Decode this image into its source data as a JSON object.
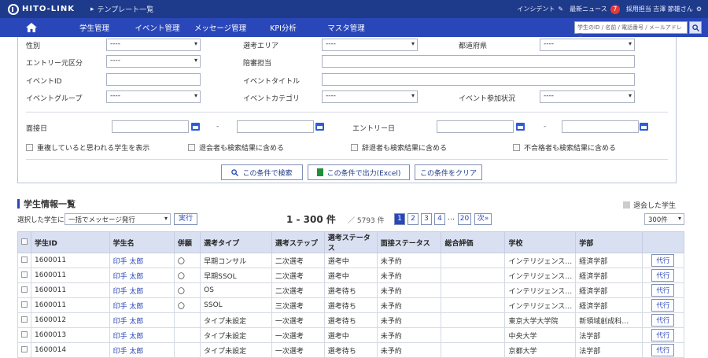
{
  "header": {
    "logo": "HITO-LINK",
    "breadcrumb": "テンプレート一覧",
    "right": [
      {
        "label": "インシデント",
        "icon": "pencil-icon"
      },
      {
        "label": "最新ニュース",
        "badge": "7"
      },
      {
        "label": "採用担当 吉澤 節雄さん",
        "icon": "gear-icon"
      }
    ]
  },
  "nav": {
    "items": [
      "学生管理",
      "イベント管理",
      "メッセージ管理",
      "KPI分析",
      "マスタ管理"
    ],
    "search_placeholder": "学生のID / 名前 / 電話番号 / メールアドレス"
  },
  "filters": {
    "row1": {
      "gender": "性別",
      "gender_val": "----",
      "area": "選考エリア",
      "area_val": "----",
      "pref": "都道府県",
      "pref_val": "----"
    },
    "row2": {
      "entry_class": "エントリー元区分",
      "entry_class_val": "----",
      "recruiter": "陪審担当"
    },
    "row3": {
      "event_id": "イベントID",
      "event_title": "イベントタイトル"
    },
    "row4": {
      "event_group": "イベントグループ",
      "event_group_val": "----",
      "event_cat": "イベントカテゴリ",
      "event_cat_val": "----",
      "event_status": "イベント参加状況",
      "event_status_val": "----"
    },
    "interview_date": "面接日",
    "entry_date": "エントリー日",
    "dash": "-",
    "checks": [
      "重複していると思われる学生を表示",
      "退会者も検索結果に含める",
      "辞退者も検索結果に含める",
      "不合格者も検索結果に含める"
    ],
    "btn_search": "この条件で検索",
    "btn_excel": "この条件で出力(Excel)",
    "btn_clear": "この条件をクリア"
  },
  "list": {
    "title": "学生情報一覧",
    "retired_label": "退会した学生",
    "selected_label": "選択した学生に",
    "bulk_action": "一括でメッセージ発行",
    "run_button": "実行",
    "range": "1 - 300 件",
    "total": "／ 5793 件",
    "pages": [
      "1",
      "2",
      "3",
      "4",
      "…",
      "20",
      "次»"
    ],
    "per_page": "300件"
  },
  "table": {
    "headers": [
      "学生ID",
      "学生名",
      "併願",
      "選考タイプ",
      "選考ステップ",
      "選考ステータス",
      "面接ステータス",
      "総合評価",
      "学校",
      "学部",
      ""
    ],
    "rows": [
      [
        "1600011",
        "印手 太郎",
        "〇",
        "早期コンサル",
        "二次選考",
        "選考中",
        "未予約",
        "",
        "インテリジェンス…",
        "経済学部",
        "代行"
      ],
      [
        "1600011",
        "印手 太郎",
        "〇",
        "早期SSOL",
        "二次選考",
        "選考中",
        "未予約",
        "",
        "インテリジェンス…",
        "経済学部",
        "代行"
      ],
      [
        "1600011",
        "印手 太郎",
        "〇",
        "OS",
        "二次選考",
        "選考待ち",
        "未予約",
        "",
        "インテリジェンス…",
        "経済学部",
        "代行"
      ],
      [
        "1600011",
        "印手 太郎",
        "〇",
        "SSOL",
        "三次選考",
        "選考待ち",
        "未予約",
        "",
        "インテリジェンス…",
        "経済学部",
        "代行"
      ],
      [
        "1600012",
        "印手 太郎",
        "",
        "タイプ未設定",
        "一次選考",
        "選考待ち",
        "未予約",
        "",
        "東京大学大学院",
        "新領域創成科…",
        "代行"
      ],
      [
        "1600013",
        "印手 太郎",
        "",
        "タイプ未設定",
        "一次選考",
        "選考中",
        "未予約",
        "",
        "中央大学",
        "法学部",
        "代行"
      ],
      [
        "1600014",
        "印手 太郎",
        "",
        "タイプ未設定",
        "一次選考",
        "選考待ち",
        "未予約",
        "",
        "京都大学",
        "法学部",
        "代行"
      ]
    ]
  }
}
